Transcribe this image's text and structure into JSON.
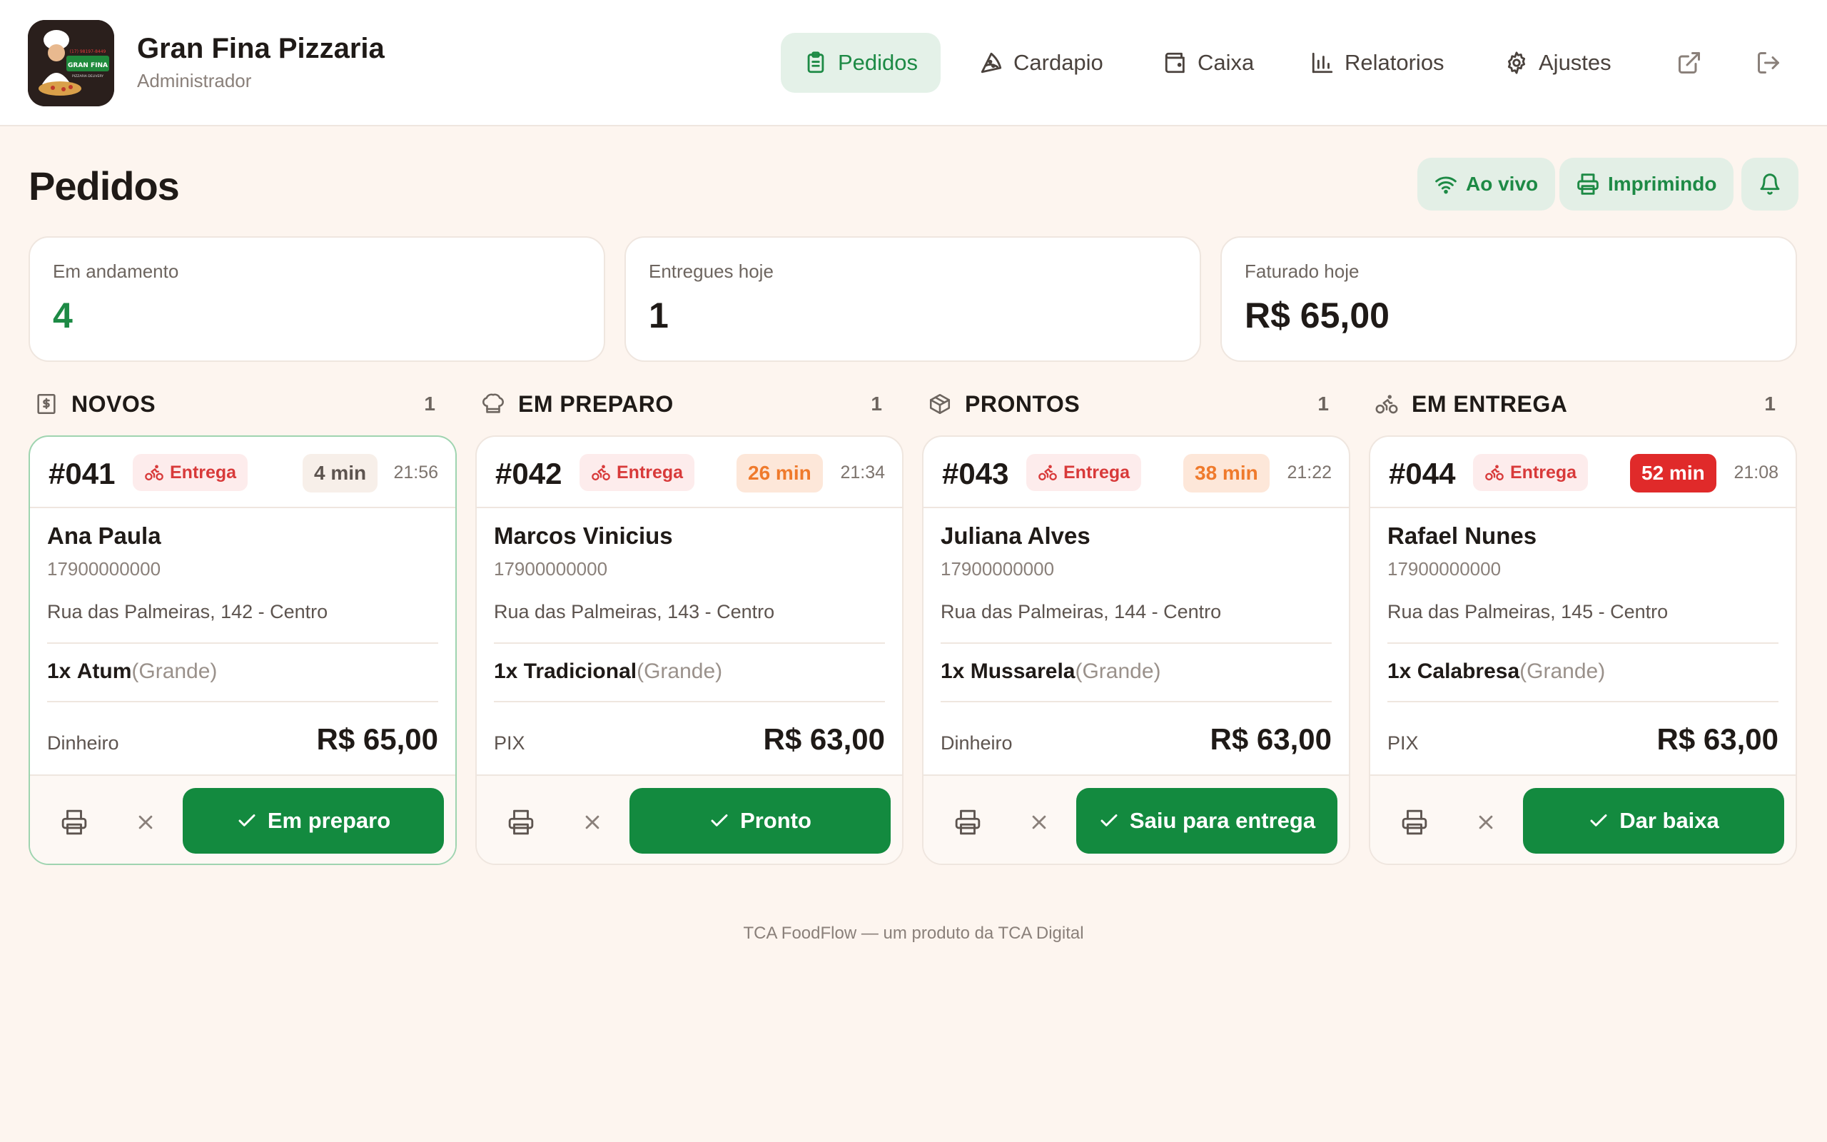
{
  "app": {
    "name": "Gran Fina Pizzaria",
    "role": "Administrador",
    "logo_text": "GRAN FINA",
    "logo_phone": "(17) 98197-8449",
    "logo_sub": "PIZZARIA DELIVERY"
  },
  "nav": [
    {
      "label": "Pedidos",
      "icon": "clipboard-icon",
      "active": true
    },
    {
      "label": "Cardapio",
      "icon": "pizza-icon"
    },
    {
      "label": "Caixa",
      "icon": "wallet-icon"
    },
    {
      "label": "Relatorios",
      "icon": "bar-chart-icon"
    },
    {
      "label": "Ajustes",
      "icon": "gear-icon"
    }
  ],
  "page": {
    "title": "Pedidos",
    "live_label": "Ao vivo",
    "print_label": "Imprimindo"
  },
  "stats": [
    {
      "label": "Em andamento",
      "value": "4",
      "color": "#1d8a45"
    },
    {
      "label": "Entregues hoje",
      "value": "1",
      "color": "#1f1a17"
    },
    {
      "label": "Faturado hoje",
      "value": "R$ 65,00",
      "color": "#1f1a17"
    }
  ],
  "columns": [
    {
      "name": "NOVOS",
      "count": "1",
      "icon": "dollar-receipt-icon",
      "order": {
        "num": "#041",
        "type": "Entrega",
        "elapsed": "4 min",
        "elapsed_state": "neutral",
        "clock": "21:56",
        "customer": "Ana Paula",
        "phone": "17900000000",
        "address": "Rua das Palmeiras, 142 - Centro",
        "qty": "1x",
        "item": "Atum",
        "size": "(Grande)",
        "payment": "Dinheiro",
        "total": "R$ 65,00",
        "action": "Em preparo"
      }
    },
    {
      "name": "EM PREPARO",
      "count": "1",
      "icon": "chef-hat-icon",
      "order": {
        "num": "#042",
        "type": "Entrega",
        "elapsed": "26 min",
        "elapsed_state": "warn",
        "clock": "21:34",
        "customer": "Marcos Vinicius",
        "phone": "17900000000",
        "address": "Rua das Palmeiras, 143 - Centro",
        "qty": "1x",
        "item": "Tradicional",
        "size": "(Grande)",
        "payment": "PIX",
        "total": "R$ 63,00",
        "action": "Pronto"
      }
    },
    {
      "name": "PRONTOS",
      "count": "1",
      "icon": "package-icon",
      "order": {
        "num": "#043",
        "type": "Entrega",
        "elapsed": "38 min",
        "elapsed_state": "warn",
        "clock": "21:22",
        "customer": "Juliana Alves",
        "phone": "17900000000",
        "address": "Rua das Palmeiras, 144 - Centro",
        "qty": "1x",
        "item": "Mussarela",
        "size": "(Grande)",
        "payment": "Dinheiro",
        "total": "R$ 63,00",
        "action": "Saiu para entrega"
      }
    },
    {
      "name": "EM ENTREGA",
      "count": "1",
      "icon": "bike-icon",
      "order": {
        "num": "#044",
        "type": "Entrega",
        "elapsed": "52 min",
        "elapsed_state": "late",
        "clock": "21:08",
        "customer": "Rafael Nunes",
        "phone": "17900000000",
        "address": "Rua das Palmeiras, 145 - Centro",
        "qty": "1x",
        "item": "Calabresa",
        "size": "(Grande)",
        "payment": "PIX",
        "total": "R$ 63,00",
        "action": "Dar baixa"
      }
    }
  ],
  "footer": "TCA FoodFlow — um produto da TCA Digital",
  "colors": {
    "accent": "#138a3f",
    "warn": "#ef7a2c",
    "late": "#e02a2a",
    "delivery": "#d83a3a"
  }
}
